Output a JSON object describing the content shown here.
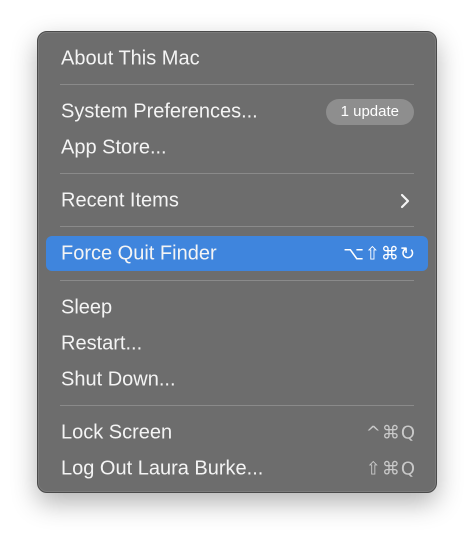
{
  "menu": {
    "items": [
      {
        "label": "About This Mac"
      },
      {
        "label": "System Preferences...",
        "badge": "1 update"
      },
      {
        "label": "App Store..."
      },
      {
        "label": "Recent Items",
        "submenu_icon": "chevron-right-icon"
      },
      {
        "label": "Force Quit Finder",
        "shortcut": "⌥⇧⌘↻",
        "highlighted": true
      },
      {
        "label": "Sleep"
      },
      {
        "label": "Restart..."
      },
      {
        "label": "Shut Down..."
      },
      {
        "label": "Lock Screen",
        "shortcut": "^⌘Q"
      },
      {
        "label": "Log Out Laura Burke...",
        "shortcut": "⇧⌘Q"
      }
    ]
  },
  "colors": {
    "menu_background": "#6d6d6d",
    "highlight": "#3f85dd",
    "text": "#f4f4f4",
    "shortcut_text": "#c9c9c9",
    "badge_background": "#8e8e8e",
    "separator": "#8a8a8a"
  }
}
